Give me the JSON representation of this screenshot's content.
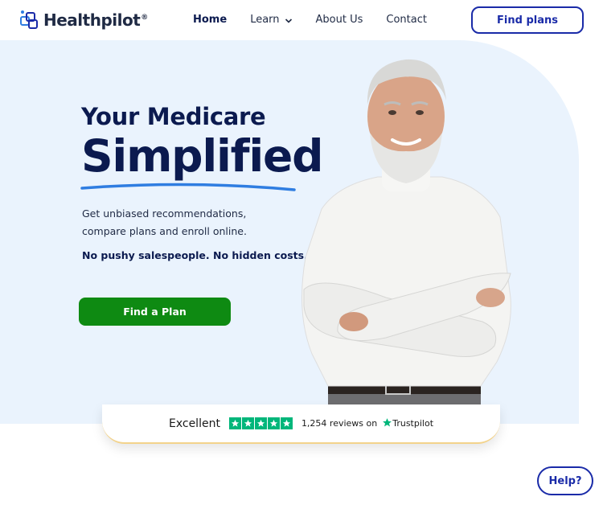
{
  "header": {
    "logo_text": "Healthpilot",
    "logo_reg": "®",
    "nav": [
      {
        "label": "Home",
        "active": true
      },
      {
        "label": "Learn",
        "has_dropdown": true
      },
      {
        "label": "About Us"
      },
      {
        "label": "Contact"
      }
    ],
    "find_plans_label": "Find plans"
  },
  "hero": {
    "title_line1": "Your Medicare",
    "title_line2": "Simplified",
    "description": "Get unbiased recommendations, compare plans and enroll online.",
    "emphasis": "No pushy salespeople. No hidden costs.",
    "cta_label": "Find a Plan"
  },
  "trust": {
    "rating_word": "Excellent",
    "stars": 5,
    "reviews_text": "1,254 reviews on",
    "brand": "Trustpilot"
  },
  "help_label": "Help?",
  "colors": {
    "navy": "#0b1a4f",
    "brand_blue": "#1a2ba8",
    "hero_bg": "#eaf3fd",
    "cta_green": "#0e8a12",
    "trustpilot_green": "#00b67a",
    "underline_blue": "#2f7de1"
  },
  "icons": [
    "healthpilot-logo-icon",
    "chevron-down-icon",
    "star-icon",
    "trustpilot-star-icon"
  ]
}
